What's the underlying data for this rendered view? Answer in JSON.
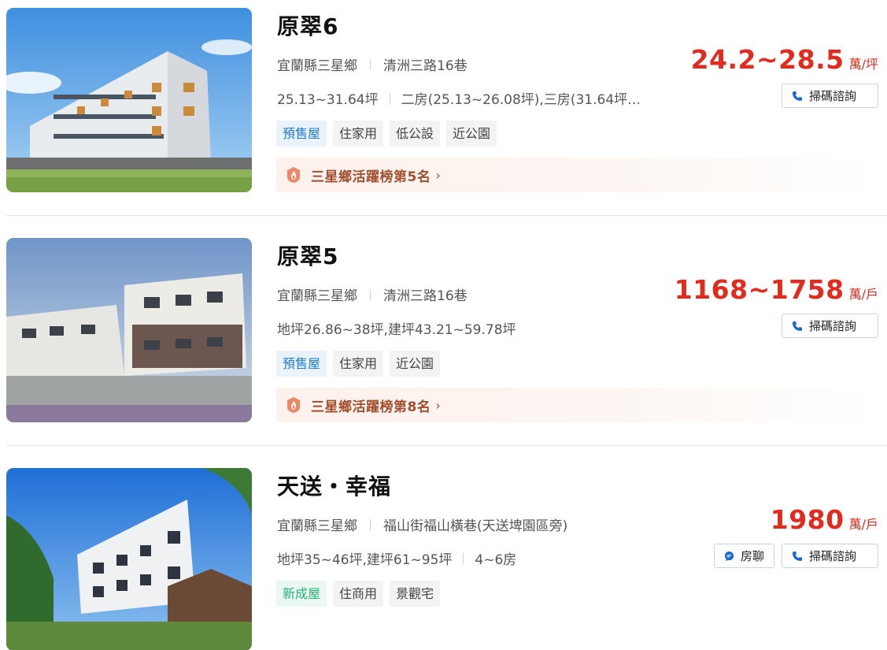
{
  "listings": [
    {
      "title": "原翠6",
      "address": {
        "district": "宜蘭縣三星鄉",
        "road": "清洲三路16巷"
      },
      "specs": [
        "25.13~31.64坪",
        "二房(25.13~26.08坪),三房(31.64坪…"
      ],
      "tags": [
        {
          "label": "預售屋",
          "style": "blue"
        },
        {
          "label": "住家用",
          "style": "gray"
        },
        {
          "label": "低公設",
          "style": "gray"
        },
        {
          "label": "近公園",
          "style": "gray"
        }
      ],
      "rank": "三星鄉活躍榜第5名",
      "price": {
        "amount": "24.2~28.5",
        "unit": "萬/坪"
      },
      "buttons": {
        "scan": "掃碼諮詢"
      }
    },
    {
      "title": "原翠5",
      "address": {
        "district": "宜蘭縣三星鄉",
        "road": "清洲三路16巷"
      },
      "specs": [
        "地坪26.86~38坪,建坪43.21~59.78坪"
      ],
      "tags": [
        {
          "label": "預售屋",
          "style": "blue"
        },
        {
          "label": "住家用",
          "style": "gray"
        },
        {
          "label": "近公園",
          "style": "gray"
        }
      ],
      "rank": "三星鄉活躍榜第8名",
      "price": {
        "amount": "1168~1758",
        "unit": "萬/戶"
      },
      "buttons": {
        "scan": "掃碼諮詢"
      }
    },
    {
      "title": "天送・幸福",
      "address": {
        "district": "宜蘭縣三星鄉",
        "road": "福山街福山橫巷(天送埤園區旁)"
      },
      "specs": [
        "地坪35~46坪,建坪61~95坪",
        "4~6房"
      ],
      "tags": [
        {
          "label": "新成屋",
          "style": "green"
        },
        {
          "label": "住商用",
          "style": "gray"
        },
        {
          "label": "景觀宅",
          "style": "gray"
        }
      ],
      "price": {
        "amount": "1980",
        "unit": "萬/戶"
      },
      "buttons": {
        "chat": "房聊",
        "scan": "掃碼諮詢"
      }
    }
  ],
  "icons": {
    "rank": "fire-medal-icon",
    "scan": "phone-icon",
    "chat": "chat-bubble-icon"
  },
  "colors": {
    "price": "#e02b1e",
    "rank_text": "#a34e2e",
    "tag_blue": "#1f7bd1",
    "tag_green": "#2bb07a",
    "icon_blue": "#1a66d6"
  }
}
